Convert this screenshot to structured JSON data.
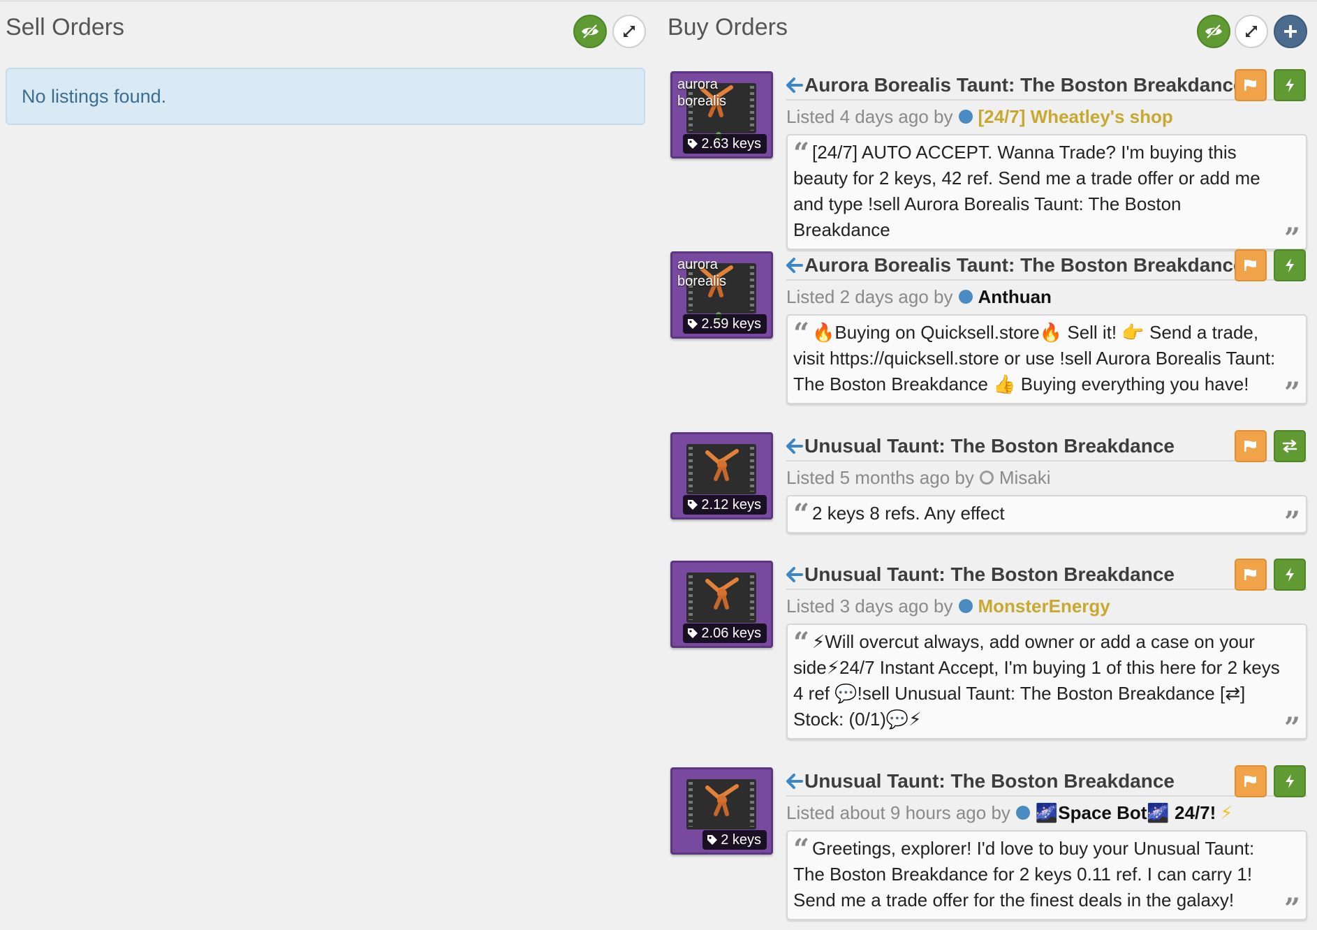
{
  "sell": {
    "title": "Sell Orders",
    "empty_text": "No listings found."
  },
  "buy": {
    "title": "Buy Orders",
    "listings": [
      {
        "effect": "aurora\nborealis",
        "price": "2.63 keys",
        "name": "Aurora Borealis Taunt: The Boston Breakdance",
        "listed": "Listed 4 days ago by",
        "user": "[24/7] Wheatley's shop",
        "action_icon": "bolt-icon",
        "message": "[24/7] AUTO ACCEPT. Wanna Trade? I'm buying this beauty for 2 keys, 42 ref. Send me a trade offer or add me and type !sell Aurora Borealis Taunt: The Boston Breakdance"
      },
      {
        "effect": "aurora\nborealis",
        "price": "2.59 keys",
        "name": "Aurora Borealis Taunt: The Boston Breakdance",
        "listed": "Listed 2 days ago by",
        "user": "Anthuan",
        "action_icon": "bolt-icon",
        "message": "🔥Buying on Quicksell.store🔥 Sell it! 👉 Send a trade, visit https://quicksell.store or use !sell Aurora Borealis Taunt: The Boston Breakdance 👍 Buying everything you have!"
      },
      {
        "effect": "",
        "price": "2.12 keys",
        "name": "Unusual Taunt: The Boston Breakdance",
        "listed": "Listed 5 months ago by",
        "user": "Misaki",
        "action_icon": "exchange-icon",
        "message": "2 keys 8 refs. Any effect"
      },
      {
        "effect": "",
        "price": "2.06 keys",
        "name": "Unusual Taunt: The Boston Breakdance",
        "listed": "Listed 3 days ago by",
        "user": "MonsterEnergy",
        "action_icon": "bolt-icon",
        "message": "⚡Will overcut always, add owner or add a case on your side⚡24/7 Instant Accept, I'm buying 1 of this here for 2 keys 4 ref 💬!sell Unusual Taunt: The Boston Breakdance [⇄] Stock: (0/1)💬⚡"
      },
      {
        "effect": "",
        "price": "2 keys",
        "name": "Unusual Taunt: The Boston Breakdance",
        "listed": "Listed about 9 hours ago by",
        "user": "🌌Space Bot🌌 24/7!",
        "user_suffix": "⚡",
        "action_icon": "bolt-icon",
        "message": "Greetings, explorer! I'd love to buy your Unusual Taunt: The Boston Breakdance for 2 keys 0.11 ref. I can carry 1! Send me a trade offer for the finest deals in the galaxy!"
      }
    ]
  },
  "colors": {
    "accent_green": "#5f9a32",
    "flag_orange": "#f0a348",
    "unusual_purple": "#774aa0",
    "user_gold": "#c8a82e",
    "alert_blue": "#daeaf5",
    "link_blue": "#4a8bc3"
  }
}
